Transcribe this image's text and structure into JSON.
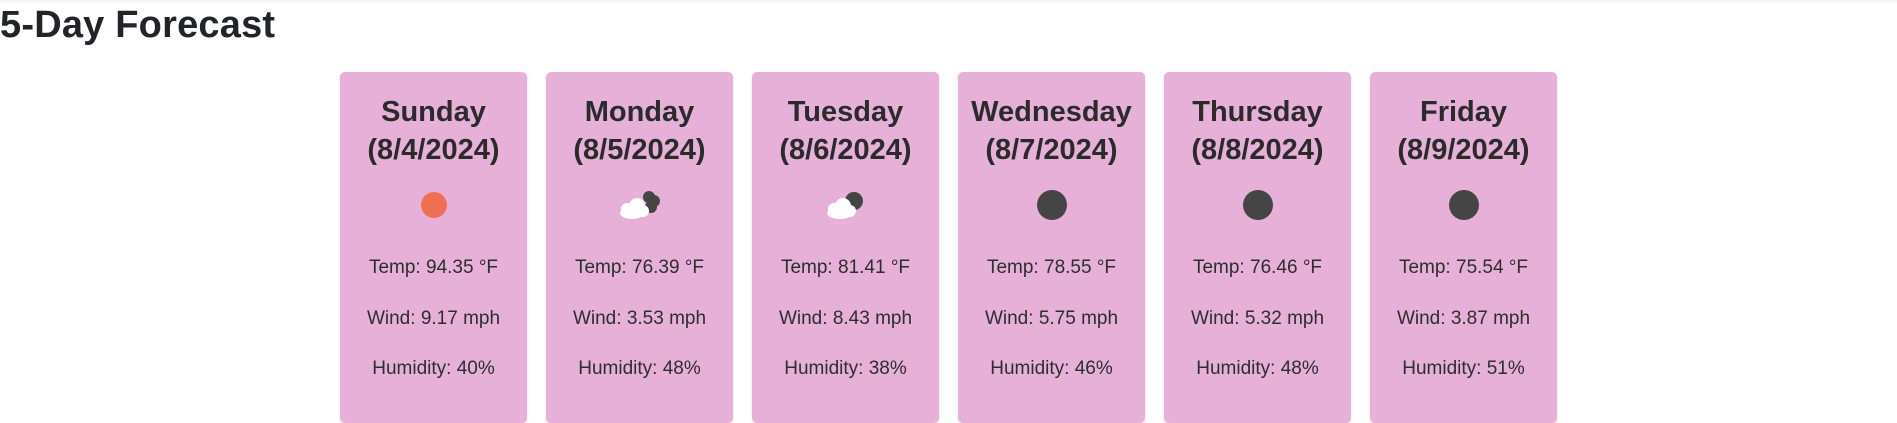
{
  "header": {
    "title": "5-Day Forecast"
  },
  "forecast": [
    {
      "day": "Sunday",
      "date": "(8/4/2024)",
      "icon": "sun-icon",
      "temp_label": "Temp:",
      "temp_value": "94.35 °F",
      "wind_label": "Wind:",
      "wind_value": "9.17 mph",
      "humidity_label": "Humidity:",
      "humidity_value": "40%"
    },
    {
      "day": "Monday",
      "date": "(8/5/2024)",
      "icon": "partly-cloudy-night-icon",
      "temp_label": "Temp:",
      "temp_value": "76.39 °F",
      "wind_label": "Wind:",
      "wind_value": "3.53 mph",
      "humidity_label": "Humidity:",
      "humidity_value": "48%"
    },
    {
      "day": "Tuesday",
      "date": "(8/6/2024)",
      "icon": "cloud-moon-icon",
      "temp_label": "Temp:",
      "temp_value": "81.41 °F",
      "wind_label": "Wind:",
      "wind_value": "8.43 mph",
      "humidity_label": "Humidity:",
      "humidity_value": "38%"
    },
    {
      "day": "Wednesday",
      "date": "(8/7/2024)",
      "icon": "dark-moon-icon",
      "temp_label": "Temp:",
      "temp_value": "78.55 °F",
      "wind_label": "Wind:",
      "wind_value": "5.75 mph",
      "humidity_label": "Humidity:",
      "humidity_value": "46%"
    },
    {
      "day": "Thursday",
      "date": "(8/8/2024)",
      "icon": "dark-moon-icon",
      "temp_label": "Temp:",
      "temp_value": "76.46 °F",
      "wind_label": "Wind:",
      "wind_value": "5.32 mph",
      "humidity_label": "Humidity:",
      "humidity_value": "48%"
    },
    {
      "day": "Friday",
      "date": "(8/9/2024)",
      "icon": "dark-moon-icon",
      "temp_label": "Temp:",
      "temp_value": "75.54 °F",
      "wind_label": "Wind:",
      "wind_value": "3.87 mph",
      "humidity_label": "Humidity:",
      "humidity_value": "51%"
    }
  ],
  "colors": {
    "card_bg": "#e6b0d8",
    "sun": "#ef6f52",
    "moon": "#454545",
    "cloud": "#ffffff"
  }
}
